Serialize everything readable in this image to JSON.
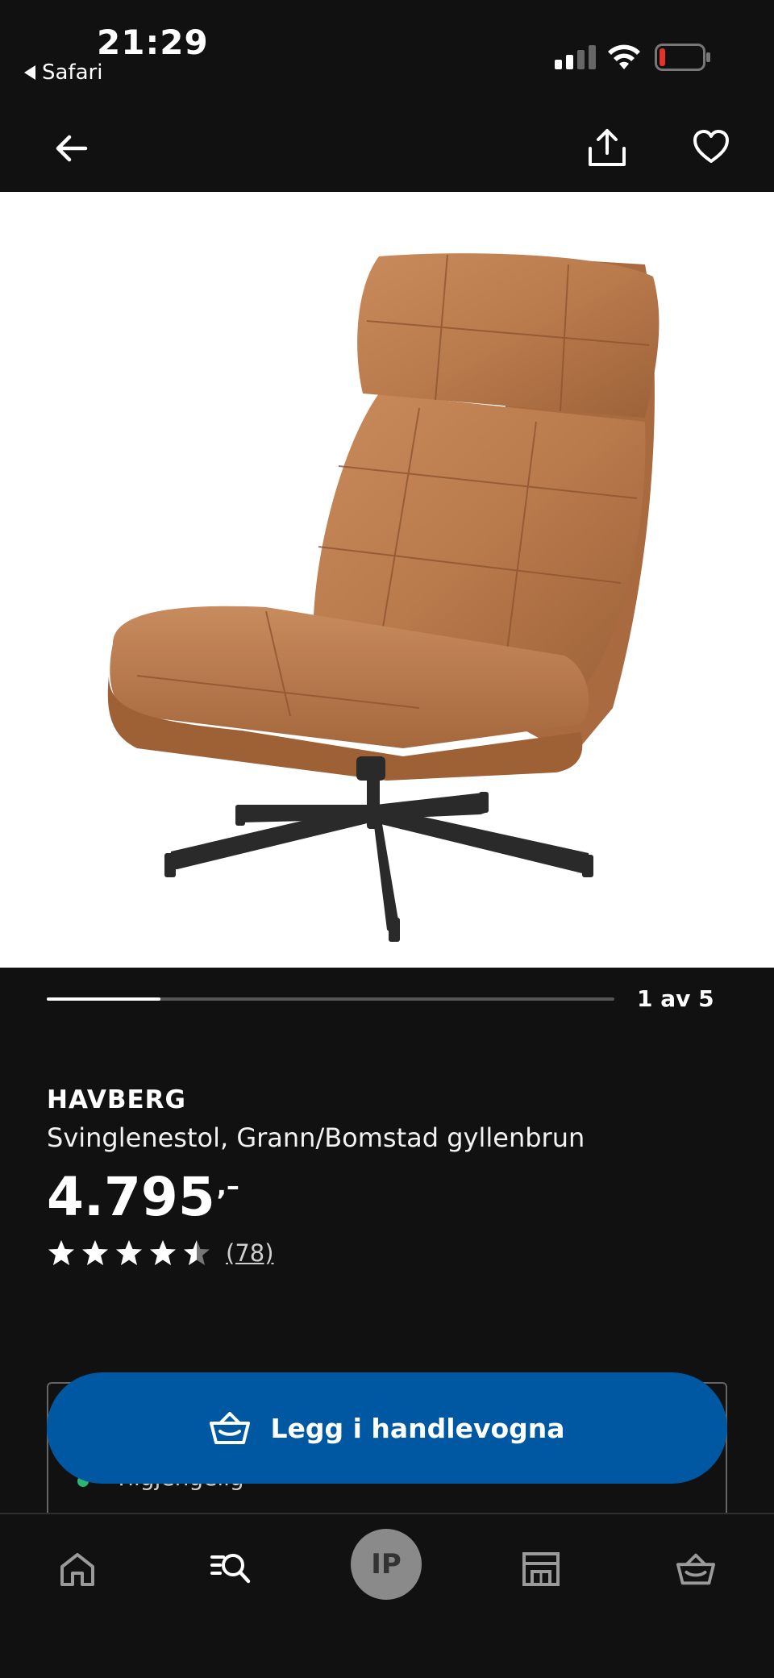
{
  "status_bar": {
    "time": "21:29",
    "back_app": "Safari",
    "icons": [
      "cellular-signal-icon",
      "wifi-icon",
      "battery-low-icon"
    ],
    "battery_color": "#e5332a"
  },
  "nav": {
    "icons": [
      "arrow-left-icon",
      "share-icon",
      "heart-icon"
    ]
  },
  "gallery": {
    "position_text": "1 av 5",
    "current": 1,
    "total": 5
  },
  "product": {
    "name": "HAVBERG",
    "description": "Svinglenestol, Grann/Bomstad gyllenbrun",
    "price": "4.795",
    "price_suffix": ",–",
    "rating": 4.5,
    "review_count": "(78)"
  },
  "availability": {
    "text": "Tilgjengelig",
    "status_color": "#2bb673"
  },
  "cart_button": {
    "label": "Legg i handlevogna",
    "icon": "shopping-basket-icon",
    "color": "#0058a3"
  },
  "tabbar": {
    "items": [
      {
        "icon": "home-icon"
      },
      {
        "icon": "search-list-icon"
      },
      {
        "icon": "profile-avatar",
        "label": "IP"
      },
      {
        "icon": "store-icon"
      },
      {
        "icon": "shopping-basket-icon"
      }
    ]
  }
}
